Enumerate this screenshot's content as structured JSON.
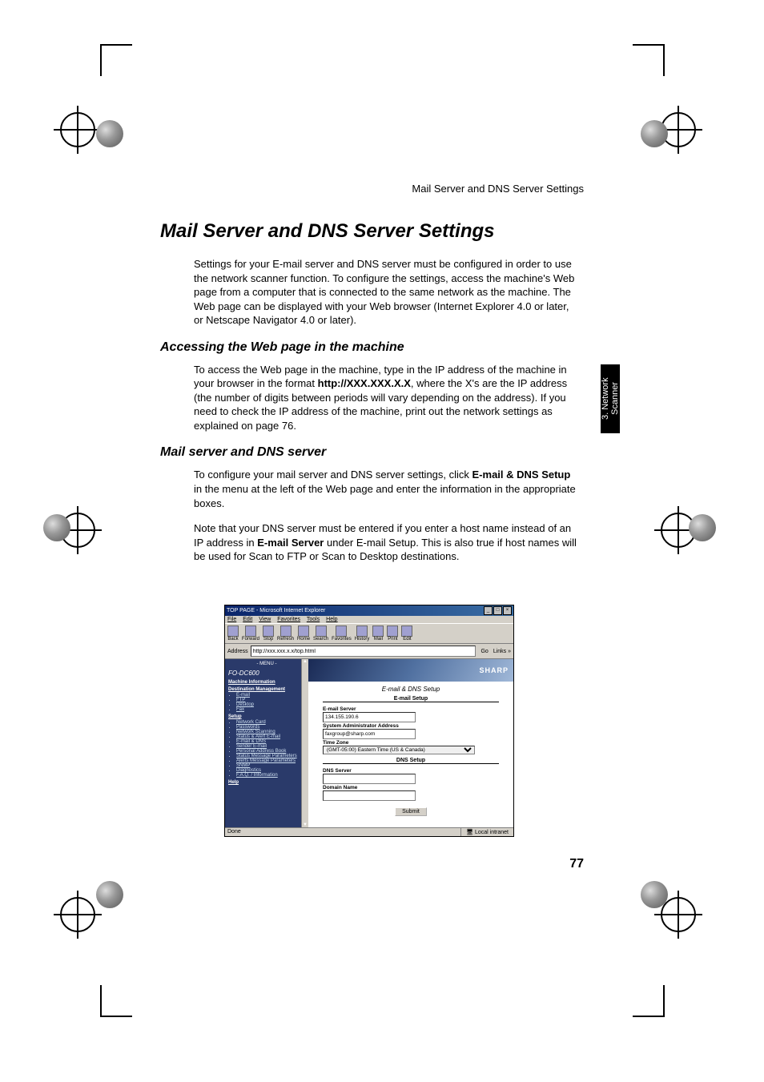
{
  "running_head": "Mail Server and DNS Server Settings",
  "title": "Mail Server and DNS Server Settings",
  "intro": "Settings for your E-mail server and DNS server must be configured in order to use the network scanner function. To configure the settings, access the machine's Web page from a computer that is connected to the same network as the machine. The Web page can be displayed with your Web browser (Internet Explorer 4.0 or later, or Netscape Navigator 4.0 or later).",
  "h2a": "Accessing the Web page in the machine",
  "p2_pre": "To access the Web page in the machine, type in the IP address of the machine in your browser in the format ",
  "p2_bold": "http://XXX.XXX.X.X",
  "p2_post": ", where the X's are the IP address (the number of digits between periods will vary depending on the address). If you need to check the IP address of the machine, print out the network settings as explained on page 76.",
  "h2b": "Mail server and DNS server",
  "p3_pre": "To configure your mail server and DNS server settings, click ",
  "p3_bold": "E-mail & DNS Setup",
  "p3_post": " in the menu at the left of the Web page and enter the information in the appropriate boxes.",
  "p4_pre": "Note that your DNS server must be entered if you enter a host name instead of an IP address in ",
  "p4_bold": "E-mail Server",
  "p4_post": " under E-mail Setup. This is also true if host names will be used for Scan to FTP or Scan to Desktop destinations.",
  "side_tab": "3. Network\nScanner",
  "page_number": "77",
  "browser": {
    "title": "TOP PAGE - Microsoft Internet Explorer",
    "menus": [
      "File",
      "Edit",
      "View",
      "Favorites",
      "Tools",
      "Help"
    ],
    "toolbar": [
      "Back",
      "Forward",
      "Stop",
      "Refresh",
      "Home",
      "Search",
      "Favorites",
      "History",
      "Mail",
      "Print",
      "Edit"
    ],
    "address_label": "Address",
    "address_value": "http://xxx.xxx.x.x/top.html",
    "go": "Go",
    "links": "Links »",
    "sidebar": {
      "menu_label": "- MENU -",
      "brand": "FO-DC600",
      "machine_info": "Machine Information",
      "dest_mgmt": "Destination Management",
      "dest_items": [
        "E-mail",
        "FTP",
        "Desktop",
        "Fax"
      ],
      "setup_label": "Setup",
      "setup_items": [
        "Network Card",
        "Passwords",
        "Network Scanning",
        "Status & Alert E-mail",
        "E-mail & DNS",
        "Sender E-mail",
        "Personal Address Book",
        "Status Message Parameters",
        "Alerts Message Parameters",
        "SNMP",
        "Diagnostics",
        "F.A.Q. / Information"
      ],
      "help": "Help"
    },
    "banner_logo": "SHARP",
    "page_heading": "E-mail & DNS Setup",
    "email_setup": {
      "section": "E-mail Setup",
      "server_label": "E-mail Server",
      "server_value": "134.155.190.6",
      "admin_label": "System Administrator Address",
      "admin_value": "faxgroup@sharp.com",
      "tz_label": "Time Zone",
      "tz_value": "(GMT-05:00) Eastern Time (US & Canada)"
    },
    "dns_setup": {
      "section": "DNS Setup",
      "server_label": "DNS Server",
      "server_value": "",
      "domain_label": "Domain Name",
      "domain_value": ""
    },
    "submit": "Submit",
    "status_left": "Done",
    "status_right": "Local intranet"
  }
}
